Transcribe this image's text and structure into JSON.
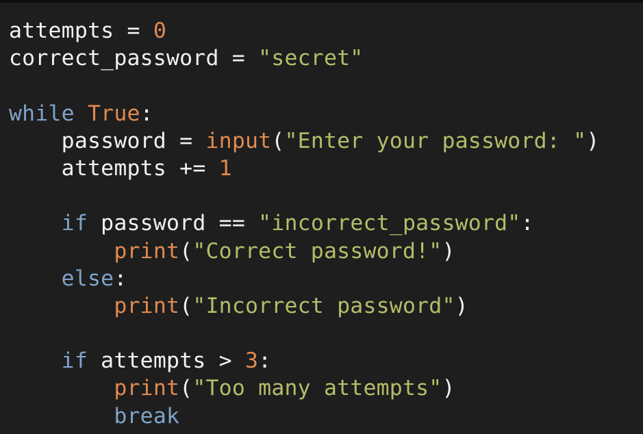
{
  "code": {
    "lines": [
      [
        {
          "text": "attempts",
          "kind": "id"
        },
        {
          "text": " = ",
          "kind": "op"
        },
        {
          "text": "0",
          "kind": "num"
        }
      ],
      [
        {
          "text": "correct_password",
          "kind": "id"
        },
        {
          "text": " = ",
          "kind": "op"
        },
        {
          "text": "\"secret\"",
          "kind": "str"
        }
      ],
      [],
      [
        {
          "text": "while",
          "kind": "kw"
        },
        {
          "text": " ",
          "kind": "op"
        },
        {
          "text": "True",
          "kind": "bool"
        },
        {
          "text": ":",
          "kind": "punc"
        }
      ],
      [
        {
          "text": "    password",
          "kind": "id"
        },
        {
          "text": " = ",
          "kind": "op"
        },
        {
          "text": "input",
          "kind": "fn"
        },
        {
          "text": "(",
          "kind": "punc"
        },
        {
          "text": "\"Enter your password: \"",
          "kind": "str"
        },
        {
          "text": ")",
          "kind": "punc"
        }
      ],
      [
        {
          "text": "    attempts",
          "kind": "id"
        },
        {
          "text": " += ",
          "kind": "op"
        },
        {
          "text": "1",
          "kind": "num"
        }
      ],
      [],
      [
        {
          "text": "    ",
          "kind": "op"
        },
        {
          "text": "if",
          "kind": "kw"
        },
        {
          "text": " password",
          "kind": "id"
        },
        {
          "text": " == ",
          "kind": "op"
        },
        {
          "text": "\"incorrect_password\"",
          "kind": "str"
        },
        {
          "text": ":",
          "kind": "punc"
        }
      ],
      [
        {
          "text": "        ",
          "kind": "op"
        },
        {
          "text": "print",
          "kind": "fn"
        },
        {
          "text": "(",
          "kind": "punc"
        },
        {
          "text": "\"Correct password!\"",
          "kind": "str"
        },
        {
          "text": ")",
          "kind": "punc"
        }
      ],
      [
        {
          "text": "    ",
          "kind": "op"
        },
        {
          "text": "else",
          "kind": "kw"
        },
        {
          "text": ":",
          "kind": "punc"
        }
      ],
      [
        {
          "text": "        ",
          "kind": "op"
        },
        {
          "text": "print",
          "kind": "fn"
        },
        {
          "text": "(",
          "kind": "punc"
        },
        {
          "text": "\"Incorrect password\"",
          "kind": "str"
        },
        {
          "text": ")",
          "kind": "punc"
        }
      ],
      [],
      [
        {
          "text": "    ",
          "kind": "op"
        },
        {
          "text": "if",
          "kind": "kw"
        },
        {
          "text": " attempts",
          "kind": "id"
        },
        {
          "text": " > ",
          "kind": "op"
        },
        {
          "text": "3",
          "kind": "num"
        },
        {
          "text": ":",
          "kind": "punc"
        }
      ],
      [
        {
          "text": "        ",
          "kind": "op"
        },
        {
          "text": "print",
          "kind": "fn"
        },
        {
          "text": "(",
          "kind": "punc"
        },
        {
          "text": "\"Too many attempts\"",
          "kind": "str"
        },
        {
          "text": ")",
          "kind": "punc"
        }
      ],
      [
        {
          "text": "        ",
          "kind": "op"
        },
        {
          "text": "break",
          "kind": "kw"
        }
      ]
    ]
  },
  "theme": {
    "background": "#1e1e1e",
    "keyword": "#7fa3c9",
    "number": "#e08a4f",
    "builtin": "#e08a4f",
    "string": "#b5bd68",
    "text": "#f2f2f2"
  }
}
